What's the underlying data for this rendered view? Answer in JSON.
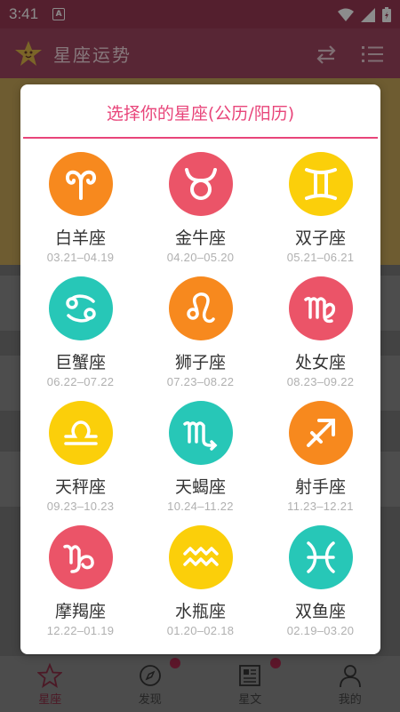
{
  "status": {
    "time": "3:41",
    "notification_icon": "A"
  },
  "app": {
    "title": "星座运势"
  },
  "nav": [
    {
      "label": "星座",
      "icon": "star-icon"
    },
    {
      "label": "发现",
      "icon": "compass-icon"
    },
    {
      "label": "星文",
      "icon": "article-icon"
    },
    {
      "label": "我的",
      "icon": "person-icon"
    }
  ],
  "dialog": {
    "title": "选择你的星座(公历/阳历)",
    "signs": [
      {
        "name": "白羊座",
        "dates": "03.21–04.19",
        "color": "#f7891e",
        "icon": "aries-icon"
      },
      {
        "name": "金牛座",
        "dates": "04.20–05.20",
        "color": "#eb5468",
        "icon": "taurus-icon"
      },
      {
        "name": "双子座",
        "dates": "05.21–06.21",
        "color": "#fbcf0a",
        "icon": "gemini-icon"
      },
      {
        "name": "巨蟹座",
        "dates": "06.22–07.22",
        "color": "#27c7b7",
        "icon": "cancer-icon"
      },
      {
        "name": "狮子座",
        "dates": "07.23–08.22",
        "color": "#f7891e",
        "icon": "leo-icon"
      },
      {
        "name": "处女座",
        "dates": "08.23–09.22",
        "color": "#eb5468",
        "icon": "virgo-icon"
      },
      {
        "name": "天秤座",
        "dates": "09.23–10.23",
        "color": "#fbcf0a",
        "icon": "libra-icon"
      },
      {
        "name": "天蝎座",
        "dates": "10.24–11.22",
        "color": "#27c7b7",
        "icon": "scorpio-icon"
      },
      {
        "name": "射手座",
        "dates": "11.23–12.21",
        "color": "#f7891e",
        "icon": "sagittarius-icon"
      },
      {
        "name": "摩羯座",
        "dates": "12.22–01.19",
        "color": "#eb5468",
        "icon": "capricorn-icon"
      },
      {
        "name": "水瓶座",
        "dates": "01.20–02.18",
        "color": "#fbcf0a",
        "icon": "aquarius-icon"
      },
      {
        "name": "双鱼座",
        "dates": "02.19–03.20",
        "color": "#27c7b7",
        "icon": "pisces-icon"
      }
    ]
  },
  "colors": {
    "accent": "#e8457a",
    "appbar": "#a14661"
  }
}
